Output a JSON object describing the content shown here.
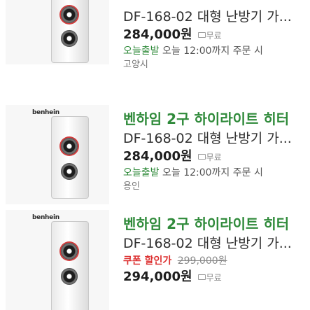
{
  "items": [
    {
      "title": "",
      "model": "DF-168-02 대형 난방기 가...",
      "price": "284,000원",
      "ship": "무료",
      "delivery_prefix": "오늘출발",
      "delivery_rest": "오늘 12:00까지 주문 시",
      "region": "고양시",
      "brand": ""
    },
    {
      "title": "벤하임 2구 하이라이트 히터",
      "model": "DF-168-02 대형 난방기 가...",
      "price": "284,000원",
      "ship": "무료",
      "delivery_prefix": "오늘출발",
      "delivery_rest": "오늘 12:00까지 주문 시",
      "region": "용인",
      "brand": "benhein"
    },
    {
      "title": "벤하임 2구 하이라이트 히터",
      "model": "DF-168-02 대형 난방기 가...",
      "coupon": "쿠폰 할인가",
      "original_price": "299,000원",
      "price": "294,000원",
      "ship": "무료",
      "brand": "benhein"
    }
  ],
  "colors": {
    "accent_green": "#2f8a3a",
    "coupon_red": "#dd3333"
  }
}
